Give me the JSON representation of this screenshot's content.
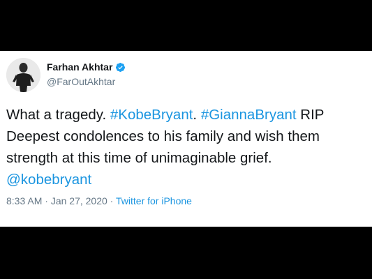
{
  "author": {
    "name": "Farhan Akhtar",
    "handle": "@FarOutAkhtar"
  },
  "tweet": {
    "line1": {
      "text": "What a tragedy. ",
      "tag1": "#KobeBryant",
      "sep": ". ",
      "tag2": "#GiannaBryant",
      "tail": " RIP"
    },
    "line2": "Deepest condolences to his family and wish them",
    "line3": "strength at this time of unimaginable grief.",
    "mention": "@kobebryant"
  },
  "meta": {
    "time": "8:33 AM",
    "sep": " · ",
    "date": "Jan 27, 2020",
    "sep2": " · ",
    "source": "Twitter for iPhone"
  },
  "colors": {
    "link": "#1b95e0",
    "verified": "#1da1f2",
    "text": "#14171a",
    "muted": "#657786"
  },
  "icons": {
    "verified": "verified-badge-icon"
  }
}
